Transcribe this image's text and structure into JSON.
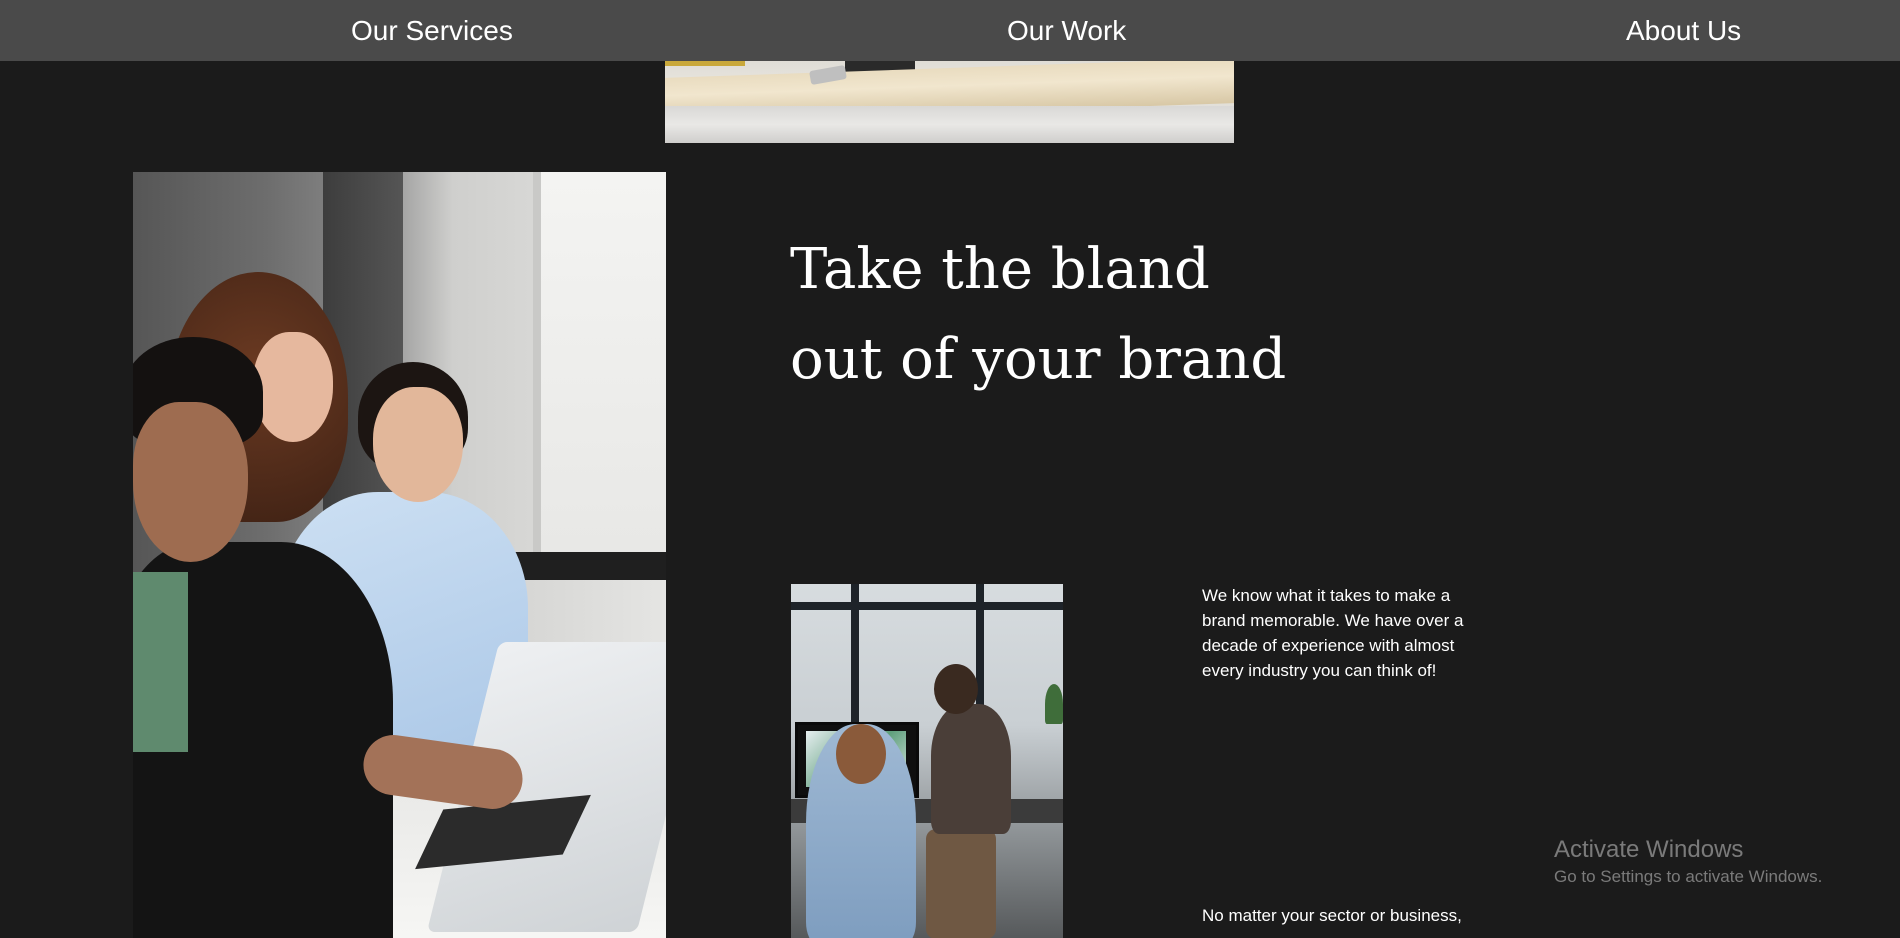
{
  "nav": {
    "items": [
      {
        "label": "Our Services"
      },
      {
        "label": "Our Work"
      },
      {
        "label": "About Us"
      }
    ]
  },
  "hero": {
    "headline_line1": "Take the bland",
    "headline_line2": "out of your brand"
  },
  "body": {
    "paragraph1": "We know what it takes to make a brand memorable. We have over a decade of experience with almost every industry you can think of!",
    "paragraph2": "No matter your sector or business,"
  },
  "watermark": {
    "title": "Activate Windows",
    "subtitle": "Go to Settings to activate Windows."
  },
  "colors": {
    "background": "#1b1b1b",
    "navbar": "#4a4a4a",
    "text": "#ffffff"
  }
}
